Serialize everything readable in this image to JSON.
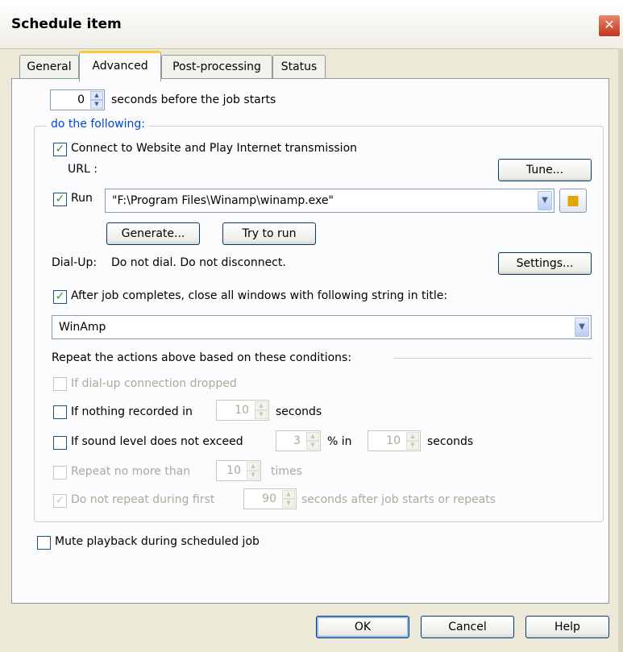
{
  "window": {
    "title": "Schedule item",
    "close_glyph": "✕"
  },
  "tabs": [
    {
      "label": "General"
    },
    {
      "label": "Advanced"
    },
    {
      "label": "Post-processing"
    },
    {
      "label": "Status"
    }
  ],
  "delay": {
    "value": "0",
    "label": "seconds before the job starts"
  },
  "group_label": "do the following:",
  "connect": {
    "checked": true,
    "label": "Connect to Website and Play Internet transmission"
  },
  "url": {
    "label": "URL :",
    "tune_button": "Tune..."
  },
  "run": {
    "checked": true,
    "label": "Run",
    "path": "\"F:\\Program Files\\Winamp\\winamp.exe\"",
    "folder_icon": "folder-icon"
  },
  "generate_button": "Generate...",
  "try_button": "Try to run",
  "dialup": {
    "label": "Dial-Up:",
    "value": "Do not dial. Do not disconnect.",
    "settings_button": "Settings..."
  },
  "close_windows": {
    "checked": true,
    "label": "After job completes, close all windows with following string in title:",
    "value": "WinAmp"
  },
  "repeat": {
    "heading": "Repeat the actions above based on these conditions:",
    "dialup_dropped": {
      "label": "If dial-up connection dropped",
      "checked": false,
      "enabled": false
    },
    "nothing_recorded": {
      "label": "If nothing recorded in",
      "value": "10",
      "unit": "seconds",
      "checked": false
    },
    "sound_level": {
      "label": "If sound level does not exceed",
      "value": "3",
      "mid": "% in",
      "value2": "10",
      "unit": "seconds",
      "checked": false
    },
    "max_times": {
      "label": "Repeat no more than",
      "value": "10",
      "unit": "times",
      "checked": false,
      "enabled": false
    },
    "no_repeat_first": {
      "label": "Do not repeat during first",
      "value": "90",
      "unit": "seconds after job starts or repeats",
      "checked": true,
      "enabled": false
    }
  },
  "mute": {
    "checked": false,
    "label": "Mute playback during scheduled job"
  },
  "footer": {
    "ok": "OK",
    "cancel": "Cancel",
    "help": "Help"
  }
}
